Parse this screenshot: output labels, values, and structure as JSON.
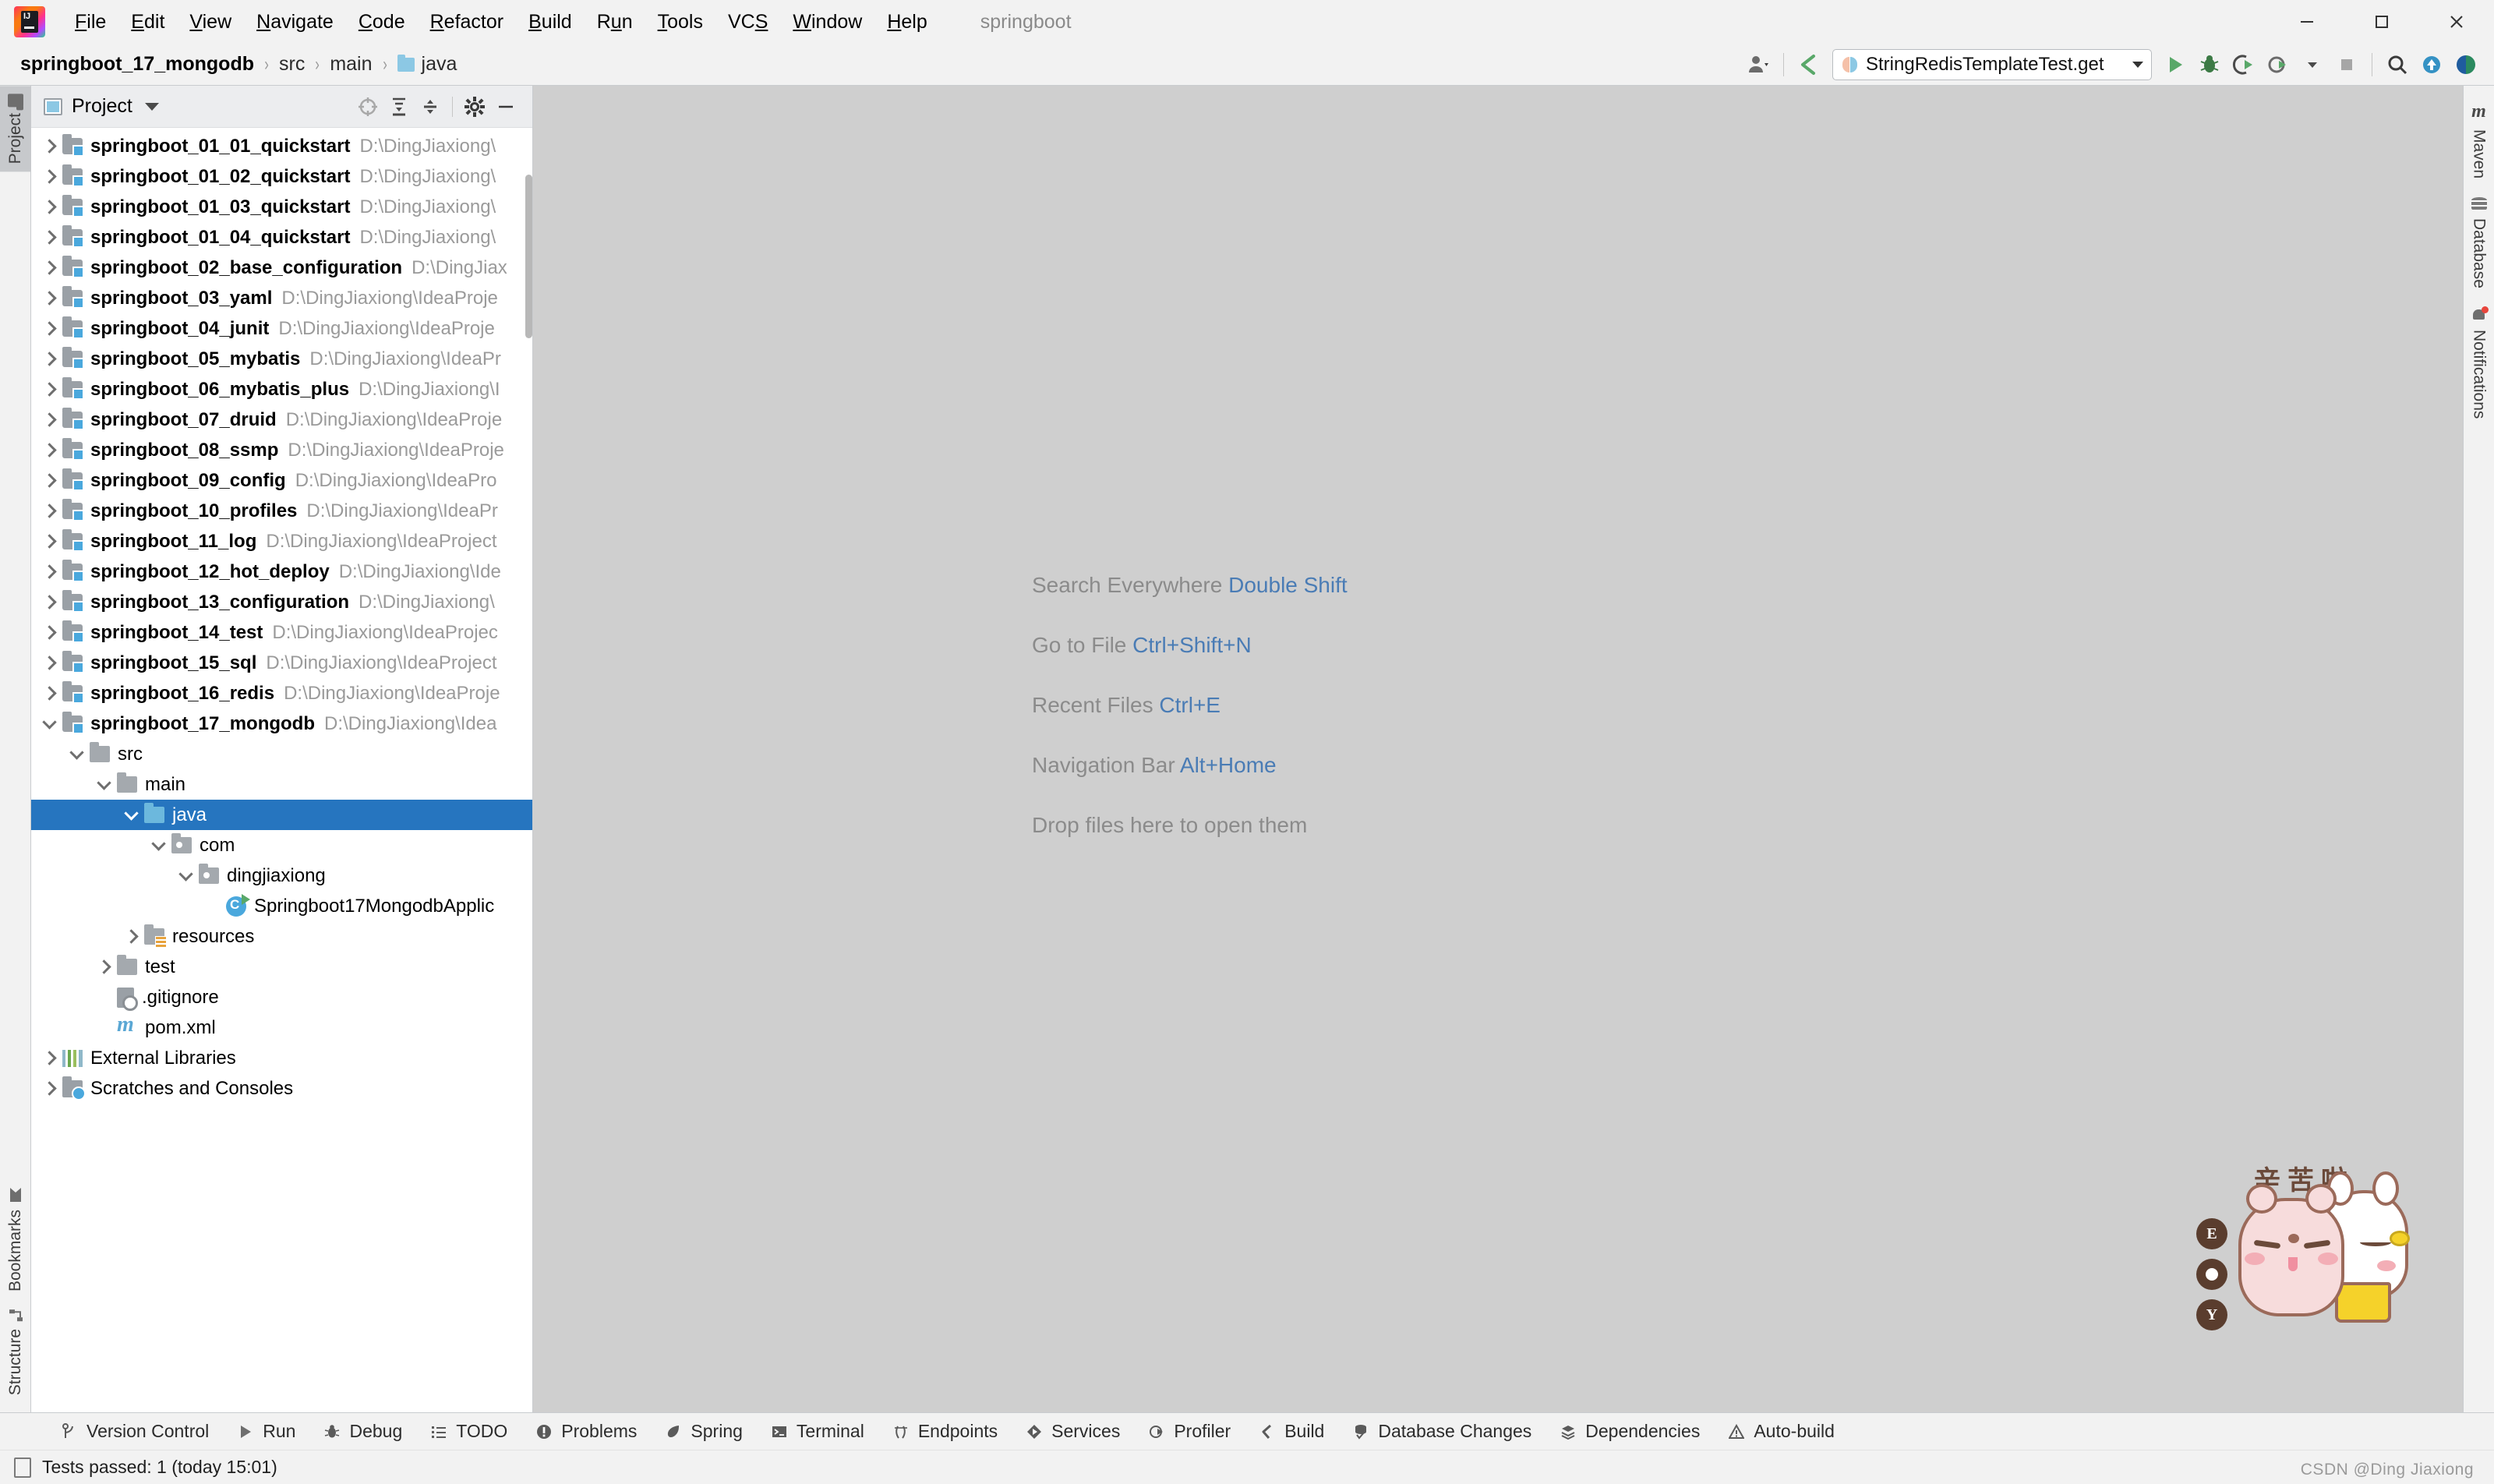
{
  "window": {
    "title": "springboot",
    "logo_icon": "intellij-idea-logo",
    "controls": [
      {
        "name": "minimize",
        "icon": "minimize-icon"
      },
      {
        "name": "maximize",
        "icon": "maximize-icon"
      },
      {
        "name": "close",
        "icon": "close-icon"
      }
    ]
  },
  "menubar": {
    "items": [
      {
        "label": "File",
        "mnemonic": "F"
      },
      {
        "label": "Edit",
        "mnemonic": "E"
      },
      {
        "label": "View",
        "mnemonic": "V"
      },
      {
        "label": "Navigate",
        "mnemonic": "N"
      },
      {
        "label": "Code",
        "mnemonic": "C"
      },
      {
        "label": "Refactor",
        "mnemonic": "R"
      },
      {
        "label": "Build",
        "mnemonic": "B"
      },
      {
        "label": "Run",
        "mnemonic": "u"
      },
      {
        "label": "Tools",
        "mnemonic": "T"
      },
      {
        "label": "VCS",
        "mnemonic": "S"
      },
      {
        "label": "Window",
        "mnemonic": "W"
      },
      {
        "label": "Help",
        "mnemonic": "H"
      }
    ]
  },
  "navbar": {
    "breadcrumbs": [
      {
        "label": "springboot_17_mongodb",
        "bold": true,
        "icon": null
      },
      {
        "label": "src",
        "bold": false,
        "icon": null
      },
      {
        "label": "main",
        "bold": false,
        "icon": null
      },
      {
        "label": "java",
        "bold": false,
        "icon": "folder-icon"
      }
    ],
    "separator": "›"
  },
  "toolbar": {
    "user_icon": "user-account-icon",
    "update_icon": "update-project-icon",
    "run_configuration": {
      "label": "StringRedisTemplateTest.get",
      "icon": "run-config-icon",
      "dropdown_icon": "chevron-down-icon"
    },
    "buttons": [
      {
        "name": "run-button",
        "icon": "run-icon",
        "color": "#59a869"
      },
      {
        "name": "debug-button",
        "icon": "debug-icon",
        "color": "#3c7a45"
      },
      {
        "name": "run-with-coverage-button",
        "icon": "coverage-icon",
        "color": "#4a4a4a"
      },
      {
        "name": "profile-button",
        "icon": "profile-icon",
        "color": "#4a4a4a"
      },
      {
        "name": "stop-button",
        "icon": "stop-icon",
        "color": "#9a9a9a"
      },
      {
        "name": "search-button",
        "icon": "search-icon",
        "color": "#4a4a4a"
      },
      {
        "name": "vcs-update-button",
        "icon": "arrow-up-circle-icon",
        "color": "#3592c4"
      },
      {
        "name": "ide-assistant-button",
        "icon": "assistant-icon",
        "color": "#2b8a5f"
      }
    ]
  },
  "left_strip": {
    "top": [
      {
        "label": "Project",
        "icon": "project-folder-icon",
        "active": true
      }
    ],
    "bottom": [
      {
        "label": "Bookmarks",
        "icon": "bookmark-icon",
        "active": false
      },
      {
        "label": "Structure",
        "icon": "structure-icon",
        "active": false
      }
    ]
  },
  "right_strip": {
    "items": [
      {
        "label": "Maven",
        "icon": "maven-icon"
      },
      {
        "label": "Database",
        "icon": "database-icon"
      },
      {
        "label": "Notifications",
        "icon": "bell-icon",
        "badge": true
      }
    ]
  },
  "project_panel": {
    "title": "Project",
    "title_icon": "project-view-icon",
    "dropdown_icon": "chevron-down-icon",
    "header_buttons": [
      {
        "name": "select-opened-file-button",
        "icon": "target-icon"
      },
      {
        "name": "expand-all-button",
        "icon": "expand-all-icon"
      },
      {
        "name": "collapse-all-button",
        "icon": "collapse-all-icon"
      },
      {
        "name": "settings-button",
        "icon": "gear-icon"
      },
      {
        "name": "hide-button",
        "icon": "minus-icon"
      }
    ],
    "tree": [
      {
        "label": "springboot_01_01_quickstart",
        "path": "D:\\DingJiaxiong\\",
        "indent": 0,
        "arrow": "closed",
        "icon": "module-icon",
        "bold": true,
        "selected": false
      },
      {
        "label": "springboot_01_02_quickstart",
        "path": "D:\\DingJiaxiong\\",
        "indent": 0,
        "arrow": "closed",
        "icon": "module-icon",
        "bold": true,
        "selected": false
      },
      {
        "label": "springboot_01_03_quickstart",
        "path": "D:\\DingJiaxiong\\",
        "indent": 0,
        "arrow": "closed",
        "icon": "module-icon",
        "bold": true,
        "selected": false
      },
      {
        "label": "springboot_01_04_quickstart",
        "path": "D:\\DingJiaxiong\\",
        "indent": 0,
        "arrow": "closed",
        "icon": "module-icon",
        "bold": true,
        "selected": false
      },
      {
        "label": "springboot_02_base_configuration",
        "path": "D:\\DingJiax",
        "indent": 0,
        "arrow": "closed",
        "icon": "module-icon",
        "bold": true,
        "selected": false
      },
      {
        "label": "springboot_03_yaml",
        "path": "D:\\DingJiaxiong\\IdeaProje",
        "indent": 0,
        "arrow": "closed",
        "icon": "module-icon",
        "bold": true,
        "selected": false
      },
      {
        "label": "springboot_04_junit",
        "path": "D:\\DingJiaxiong\\IdeaProje",
        "indent": 0,
        "arrow": "closed",
        "icon": "module-icon",
        "bold": true,
        "selected": false
      },
      {
        "label": "springboot_05_mybatis",
        "path": "D:\\DingJiaxiong\\IdeaPr",
        "indent": 0,
        "arrow": "closed",
        "icon": "module-icon",
        "bold": true,
        "selected": false
      },
      {
        "label": "springboot_06_mybatis_plus",
        "path": "D:\\DingJiaxiong\\I",
        "indent": 0,
        "arrow": "closed",
        "icon": "module-icon",
        "bold": true,
        "selected": false
      },
      {
        "label": "springboot_07_druid",
        "path": "D:\\DingJiaxiong\\IdeaProje",
        "indent": 0,
        "arrow": "closed",
        "icon": "module-icon",
        "bold": true,
        "selected": false
      },
      {
        "label": "springboot_08_ssmp",
        "path": "D:\\DingJiaxiong\\IdeaProje",
        "indent": 0,
        "arrow": "closed",
        "icon": "module-icon",
        "bold": true,
        "selected": false
      },
      {
        "label": "springboot_09_config",
        "path": "D:\\DingJiaxiong\\IdeaPro",
        "indent": 0,
        "arrow": "closed",
        "icon": "module-icon",
        "bold": true,
        "selected": false
      },
      {
        "label": "springboot_10_profiles",
        "path": "D:\\DingJiaxiong\\IdeaPr",
        "indent": 0,
        "arrow": "closed",
        "icon": "module-icon",
        "bold": true,
        "selected": false
      },
      {
        "label": "springboot_11_log",
        "path": "D:\\DingJiaxiong\\IdeaProject",
        "indent": 0,
        "arrow": "closed",
        "icon": "module-icon",
        "bold": true,
        "selected": false
      },
      {
        "label": "springboot_12_hot_deploy",
        "path": "D:\\DingJiaxiong\\Ide",
        "indent": 0,
        "arrow": "closed",
        "icon": "module-icon",
        "bold": true,
        "selected": false
      },
      {
        "label": "springboot_13_configuration",
        "path": "D:\\DingJiaxiong\\",
        "indent": 0,
        "arrow": "closed",
        "icon": "module-icon",
        "bold": true,
        "selected": false
      },
      {
        "label": "springboot_14_test",
        "path": "D:\\DingJiaxiong\\IdeaProjec",
        "indent": 0,
        "arrow": "closed",
        "icon": "module-icon",
        "bold": true,
        "selected": false
      },
      {
        "label": "springboot_15_sql",
        "path": "D:\\DingJiaxiong\\IdeaProject",
        "indent": 0,
        "arrow": "closed",
        "icon": "module-icon",
        "bold": true,
        "selected": false
      },
      {
        "label": "springboot_16_redis",
        "path": "D:\\DingJiaxiong\\IdeaProje",
        "indent": 0,
        "arrow": "closed",
        "icon": "module-icon",
        "bold": true,
        "selected": false
      },
      {
        "label": "springboot_17_mongodb",
        "path": "D:\\DingJiaxiong\\Idea",
        "indent": 0,
        "arrow": "open",
        "icon": "module-icon",
        "bold": true,
        "selected": false
      },
      {
        "label": "src",
        "path": "",
        "indent": 1,
        "arrow": "open",
        "icon": "folder-icon",
        "bold": false,
        "selected": false
      },
      {
        "label": "main",
        "path": "",
        "indent": 2,
        "arrow": "open",
        "icon": "folder-icon",
        "bold": false,
        "selected": false
      },
      {
        "label": "java",
        "path": "",
        "indent": 3,
        "arrow": "open",
        "icon": "source-folder-icon",
        "bold": false,
        "selected": true
      },
      {
        "label": "com",
        "path": "",
        "indent": 4,
        "arrow": "open",
        "icon": "package-icon",
        "bold": false,
        "selected": false
      },
      {
        "label": "dingjiaxiong",
        "path": "",
        "indent": 5,
        "arrow": "open",
        "icon": "package-icon",
        "bold": false,
        "selected": false
      },
      {
        "label": "Springboot17MongodbApplic",
        "path": "",
        "indent": 6,
        "arrow": "none",
        "icon": "java-class-icon",
        "bold": false,
        "selected": false
      },
      {
        "label": "resources",
        "path": "",
        "indent": 3,
        "arrow": "closed",
        "icon": "resources-folder-icon",
        "bold": false,
        "selected": false
      },
      {
        "label": "test",
        "path": "",
        "indent": 2,
        "arrow": "closed",
        "icon": "folder-icon",
        "bold": false,
        "selected": false
      },
      {
        "label": ".gitignore",
        "path": "",
        "indent": 2,
        "arrow": "none",
        "icon": "gitignore-icon",
        "bold": false,
        "selected": false
      },
      {
        "label": "pom.xml",
        "path": "",
        "indent": 2,
        "arrow": "none",
        "icon": "maven-pom-icon",
        "bold": false,
        "selected": false
      },
      {
        "label": "External Libraries",
        "path": "",
        "indent": 0,
        "arrow": "closed",
        "icon": "external-libraries-icon",
        "bold": false,
        "selected": false
      },
      {
        "label": "Scratches and Consoles",
        "path": "",
        "indent": 0,
        "arrow": "closed",
        "icon": "scratches-icon",
        "bold": false,
        "selected": false
      }
    ]
  },
  "editor": {
    "tips": [
      {
        "text": "Search Everywhere",
        "key": "Double Shift"
      },
      {
        "text": "Go to File",
        "key": "Ctrl+Shift+N"
      },
      {
        "text": "Recent Files",
        "key": "Ctrl+E"
      },
      {
        "text": "Navigation Bar",
        "key": "Alt+Home"
      },
      {
        "text": "Drop files here to open them",
        "key": ""
      }
    ]
  },
  "toolwindow_bar": {
    "items": [
      {
        "label": "Version Control",
        "icon": "branch-icon"
      },
      {
        "label": "Run",
        "icon": "run-icon"
      },
      {
        "label": "Debug",
        "icon": "debug-icon"
      },
      {
        "label": "TODO",
        "icon": "todo-list-icon"
      },
      {
        "label": "Problems",
        "icon": "problems-icon"
      },
      {
        "label": "Spring",
        "icon": "spring-leaf-icon"
      },
      {
        "label": "Terminal",
        "icon": "terminal-icon"
      },
      {
        "label": "Endpoints",
        "icon": "endpoints-icon"
      },
      {
        "label": "Services",
        "icon": "services-icon"
      },
      {
        "label": "Profiler",
        "icon": "profiler-icon"
      },
      {
        "label": "Build",
        "icon": "build-hammer-icon"
      },
      {
        "label": "Database Changes",
        "icon": "database-changes-icon"
      },
      {
        "label": "Dependencies",
        "icon": "dependencies-icon"
      },
      {
        "label": "Auto-build",
        "icon": "warning-triangle-icon"
      }
    ]
  },
  "statusbar": {
    "icon": "test-results-icon",
    "text": "Tests passed: 1 (today 15:01)",
    "watermark": "CSDN @Ding Jiaxiong"
  },
  "sticker": {
    "caption": "辛苦啦",
    "badges": [
      "E",
      "●",
      "Y"
    ]
  },
  "colors": {
    "selection": "#2675bf",
    "editor_bg": "#cfcfcf",
    "panel_bg": "#f2f2f2",
    "tip_key": "#4a7cb5",
    "tip_text": "#8b8b8b"
  }
}
